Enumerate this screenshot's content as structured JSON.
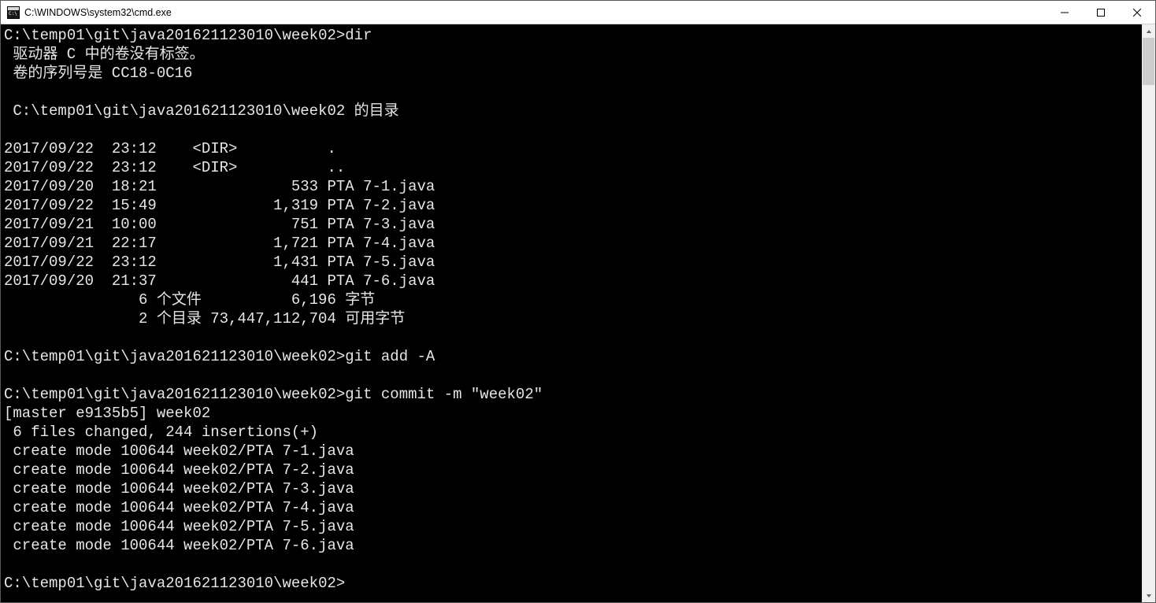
{
  "window": {
    "title": "C:\\WINDOWS\\system32\\cmd.exe"
  },
  "terminal": {
    "prompt": "C:\\temp01\\git\\java201621123010\\week02>",
    "cmd_dir": "dir",
    "vol_line": " 驱动器 C 中的卷没有标签。",
    "serial_line": " 卷的序列号是 CC18-0C16",
    "dir_of_line": " C:\\temp01\\git\\java201621123010\\week02 的目录",
    "entries": [
      "2017/09/22  23:12    <DIR>          .",
      "2017/09/22  23:12    <DIR>          ..",
      "2017/09/20  18:21               533 PTA 7-1.java",
      "2017/09/22  15:49             1,319 PTA 7-2.java",
      "2017/09/21  10:00               751 PTA 7-3.java",
      "2017/09/21  22:17             1,721 PTA 7-4.java",
      "2017/09/22  23:12             1,431 PTA 7-5.java",
      "2017/09/20  21:37               441 PTA 7-6.java"
    ],
    "summary_files": "               6 个文件          6,196 字节",
    "summary_dirs": "               2 个目录 73,447,112,704 可用字节",
    "cmd_add": "git add -A",
    "cmd_commit": "git commit -m \"week02\"",
    "commit_header": "[master e9135b5] week02",
    "commit_stats": " 6 files changed, 244 insertions(+)",
    "creates": [
      " create mode 100644 week02/PTA 7-1.java",
      " create mode 100644 week02/PTA 7-2.java",
      " create mode 100644 week02/PTA 7-3.java",
      " create mode 100644 week02/PTA 7-4.java",
      " create mode 100644 week02/PTA 7-5.java",
      " create mode 100644 week02/PTA 7-6.java"
    ]
  }
}
